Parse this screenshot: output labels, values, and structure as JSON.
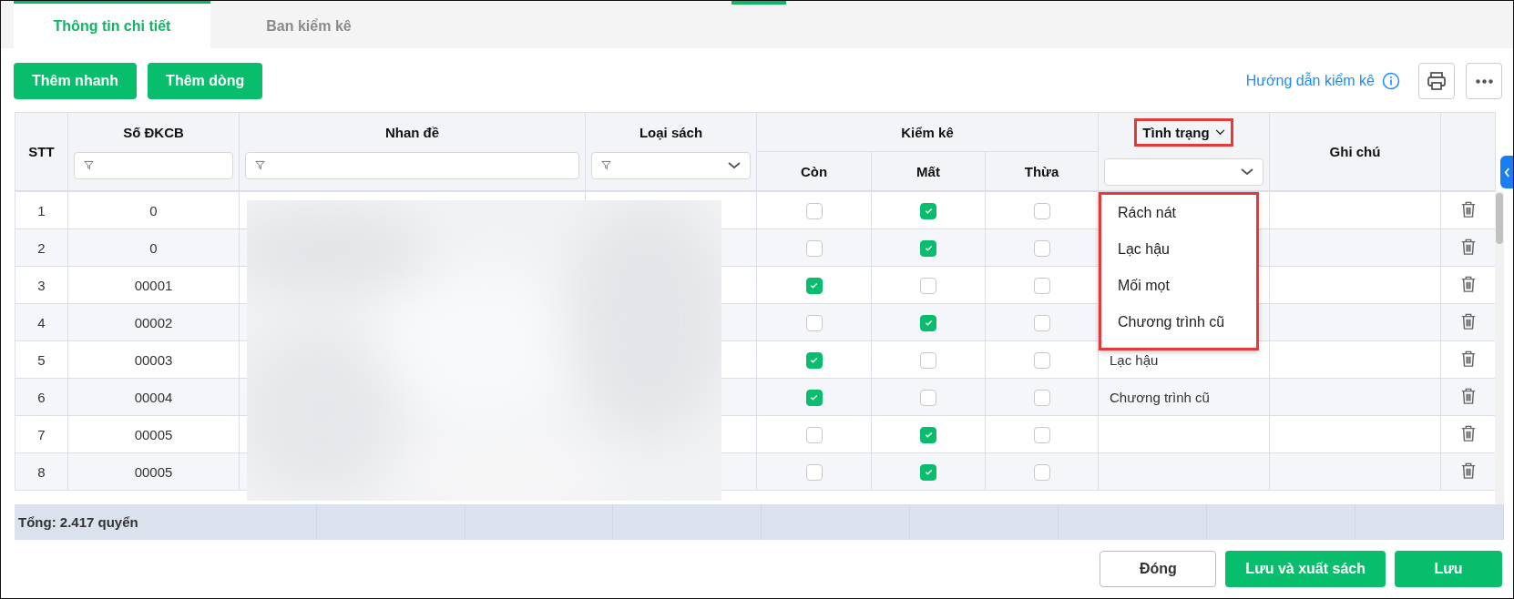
{
  "tabs": [
    {
      "label": "Thông tin chi tiết",
      "selected": true
    },
    {
      "label": "Ban kiểm kê",
      "selected": false
    }
  ],
  "toolbar": {
    "buttons": [
      "Thêm nhanh",
      "Thêm dòng"
    ],
    "help_link": "Hướng dẫn kiểm kê"
  },
  "table": {
    "columns": {
      "stt": "STT",
      "so_dkcb": "Số ĐKCB",
      "nhan_de": "Nhan đề",
      "loai_sach": "Loại sách",
      "kiem_ke": "Kiểm kê",
      "con": "Còn",
      "mat": "Mất",
      "thua": "Thừa",
      "tinh_trang": "Tình trạng",
      "ghi_chu": "Ghi chú"
    },
    "rows": [
      {
        "stt": "1",
        "so_dkcb": "0",
        "con": false,
        "mat": true,
        "thua": false
      },
      {
        "stt": "2",
        "so_dkcb": "0",
        "con": false,
        "mat": true,
        "thua": false
      },
      {
        "stt": "3",
        "so_dkcb": "00001",
        "con": true,
        "mat": false,
        "thua": false
      },
      {
        "stt": "4",
        "so_dkcb": "00002",
        "con": false,
        "mat": true,
        "thua": false
      },
      {
        "stt": "5",
        "so_dkcb": "00003",
        "con": true,
        "mat": false,
        "thua": false,
        "tinh_trang": "Lạc hậu"
      },
      {
        "stt": "6",
        "so_dkcb": "00004",
        "con": true,
        "mat": false,
        "thua": false,
        "tinh_trang": "Chương trình cũ"
      },
      {
        "stt": "7",
        "so_dkcb": "00005",
        "con": false,
        "mat": true,
        "thua": false
      },
      {
        "stt": "8",
        "so_dkcb": "00005",
        "con": false,
        "mat": true,
        "thua": false
      }
    ],
    "status_menu": {
      "open": true,
      "options": [
        "Rách nát",
        "Lạc hậu",
        "Mối mọt",
        "Chương trình cũ"
      ]
    },
    "total": "Tổng: 2.417 quyển"
  },
  "footer_buttons": [
    {
      "label": "Đóng",
      "kind": "secondary"
    },
    {
      "label": "Lưu và xuất sách",
      "kind": "primary"
    },
    {
      "label": "Lưu",
      "kind": "primary"
    }
  ]
}
